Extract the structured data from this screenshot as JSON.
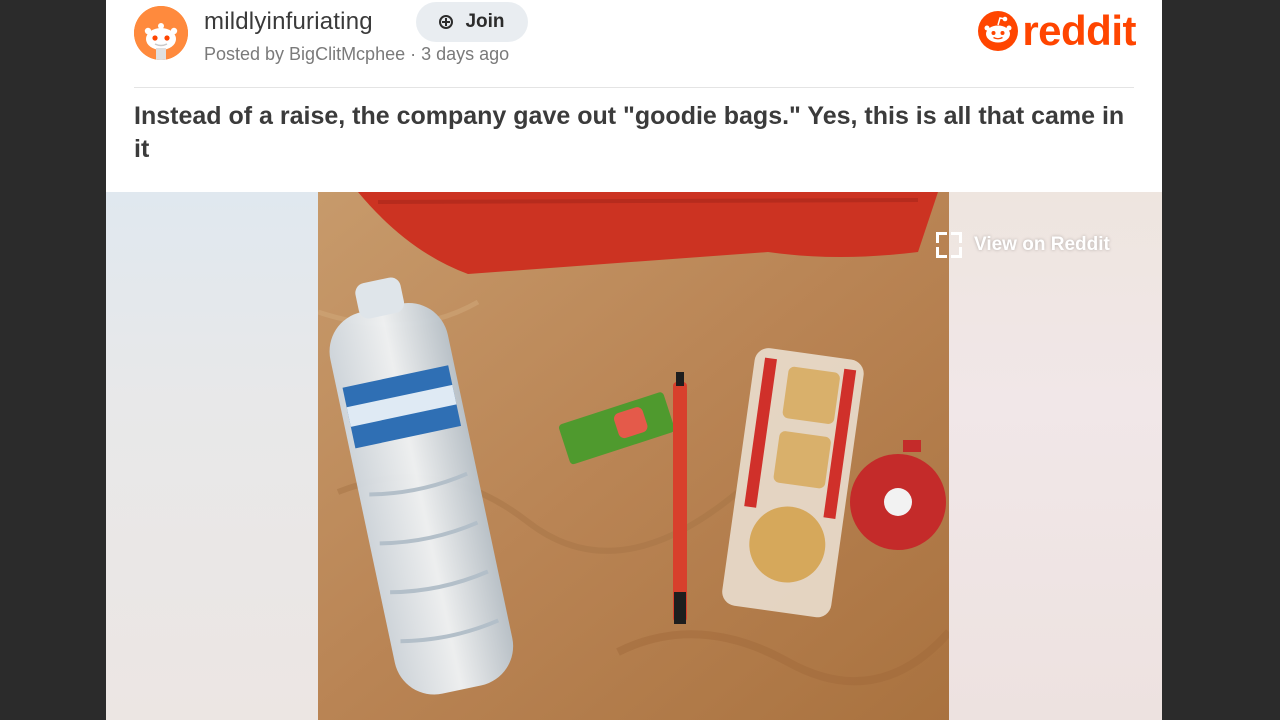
{
  "post": {
    "subreddit": "mildlyinfuriating",
    "join_label": "Join",
    "posted_by": "Posted by BigClitMcphee",
    "separator": " · ",
    "posted_time": "3 days ago",
    "title": "Instead of a raise, the company gave out \"goodie bags.\" Yes, this is all that came in it"
  },
  "brand": {
    "name": "reddit",
    "color": "#ff4500"
  },
  "media": {
    "view_label": "View on Reddit"
  },
  "icons": {
    "join": "plus-circle-icon",
    "view": "expand-icon",
    "brand": "snoo-icon"
  }
}
